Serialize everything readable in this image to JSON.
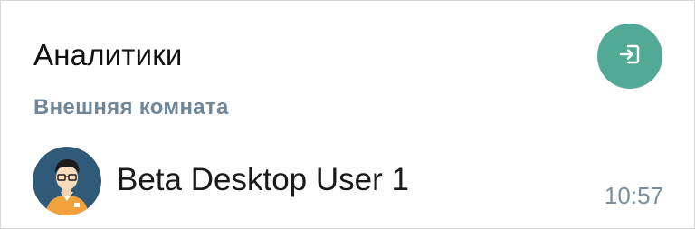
{
  "room": {
    "title": "Аналитики",
    "subtitle": "Внешняя комната"
  },
  "enter_button": {
    "icon": "enter-icon",
    "color": "#52a995"
  },
  "message": {
    "user_name": "Beta Desktop User 1",
    "time": "10:57"
  },
  "colors": {
    "subtitle": "#6f8799",
    "time": "#7b8f9e",
    "avatar_bg": "#2f5a78"
  }
}
